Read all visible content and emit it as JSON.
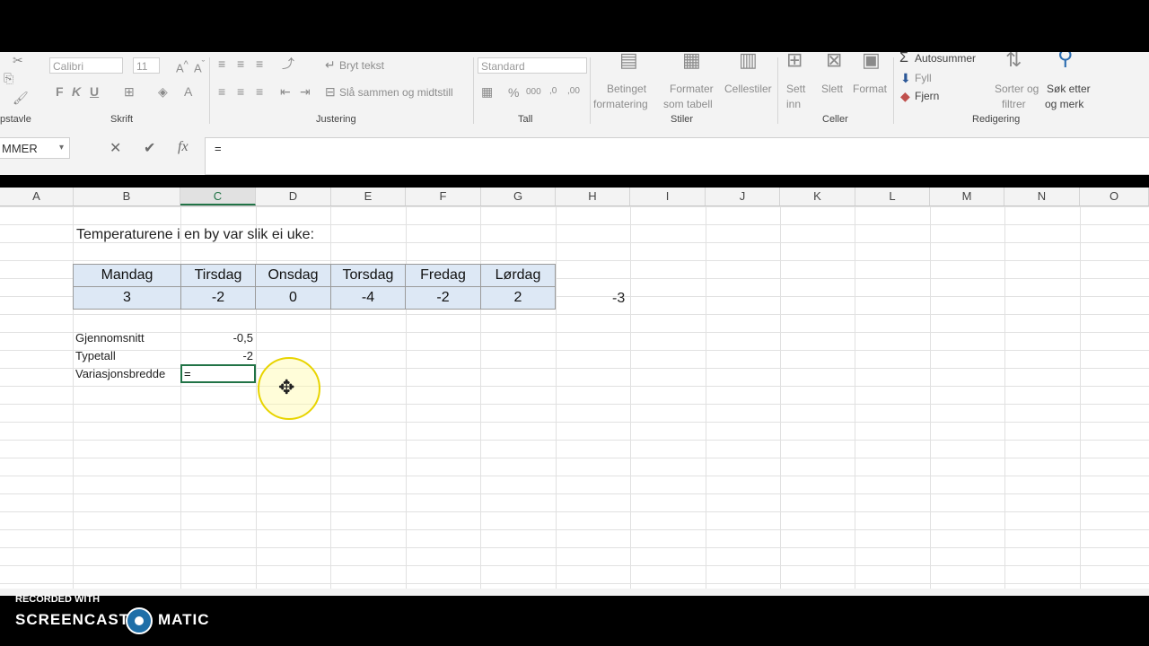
{
  "ribbon": {
    "font_name": "Calibri",
    "font_size": "11",
    "bold": "F",
    "italic": "K",
    "underline": "U",
    "wrap_text": "Bryt tekst",
    "merge_center": "Slå sammen og midtstill",
    "number_format": "Standard",
    "cond_format_1": "Betinget",
    "cond_format_2": "formatering",
    "format_table_1": "Formater",
    "format_table_2": "som tabell",
    "cell_styles": "Cellestiler",
    "insert_1": "Sett",
    "insert_2": "inn",
    "delete": "Slett",
    "format": "Format",
    "autosum": "Autosummer",
    "fill": "Fyll",
    "clear": "Fjern",
    "sort_1": "Sorter og",
    "sort_2": "filtrer",
    "find_1": "Søk etter",
    "find_2": "og merk",
    "groups": {
      "clipboard": "pstavle",
      "font": "Skrift",
      "alignment": "Justering",
      "number": "Tall",
      "styles": "Stiler",
      "cells": "Celler",
      "editing": "Redigering"
    }
  },
  "formula_bar": {
    "name_box": "MMER",
    "cancel": "✕",
    "enter": "✔",
    "fx": "fx",
    "formula": "="
  },
  "columns": [
    "A",
    "B",
    "C",
    "D",
    "E",
    "F",
    "G",
    "H",
    "I",
    "J",
    "K",
    "L",
    "M",
    "N",
    "O"
  ],
  "sheet": {
    "title": "Temperaturene i en by var slik ei uke:",
    "days": [
      "Mandag",
      "Tirsdag",
      "Onsdag",
      "Torsdag",
      "Fredag",
      "Lørdag"
    ],
    "temps": [
      "3",
      "-2",
      "0",
      "-4",
      "-2",
      "2"
    ],
    "h_value": "-3",
    "stats": [
      {
        "label": "Gjennomsnitt",
        "value": "-0,5"
      },
      {
        "label": "Typetall",
        "value": "-2"
      },
      {
        "label": "Variasjonsbredde",
        "value": "="
      }
    ]
  },
  "watermark": {
    "line1": "RECORDED WITH",
    "brand_a": "SCREENCAST",
    "brand_b": "MATIC"
  }
}
